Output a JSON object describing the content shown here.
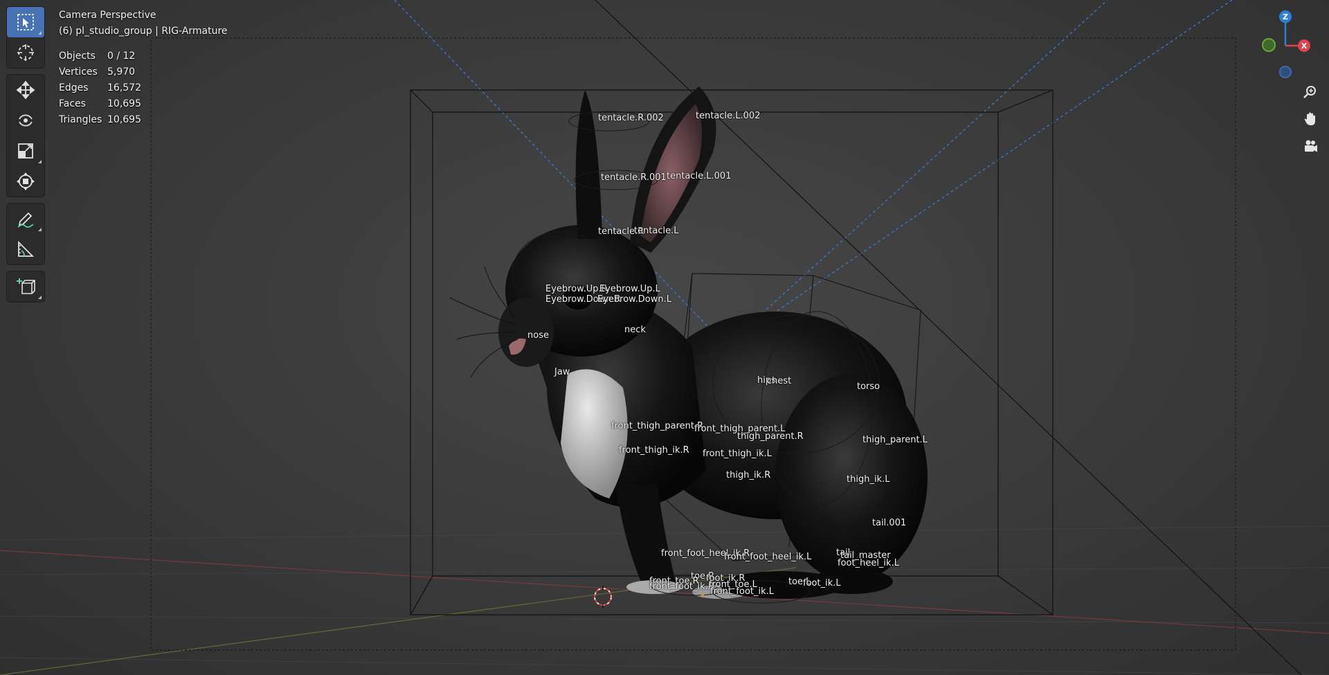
{
  "viewport": {
    "view_name": "Camera Perspective",
    "context": "(6) pl_studio_group | RIG-Armature"
  },
  "stats": [
    {
      "label": "Objects",
      "value": "0 / 12"
    },
    {
      "label": "Vertices",
      "value": "5,970"
    },
    {
      "label": "Edges",
      "value": "16,572"
    },
    {
      "label": "Faces",
      "value": "10,695"
    },
    {
      "label": "Triangles",
      "value": "10,695"
    }
  ],
  "toolbar": {
    "tools": [
      {
        "name": "select-box",
        "icon": "select-box-icon",
        "active": true
      },
      {
        "name": "cursor",
        "icon": "cursor-icon"
      },
      {
        "name": "move",
        "icon": "move-icon"
      },
      {
        "name": "rotate",
        "icon": "rotate-icon"
      },
      {
        "name": "scale",
        "icon": "scale-icon"
      },
      {
        "name": "transform",
        "icon": "transform-icon"
      },
      {
        "name": "annotate",
        "icon": "annotate-icon"
      },
      {
        "name": "measure",
        "icon": "measure-icon"
      },
      {
        "name": "add-cube",
        "icon": "add-cube-icon"
      }
    ]
  },
  "gizmo": {
    "z": "Z",
    "x": "X",
    "z_color": "#2f7fd6",
    "x_color": "#e0414d",
    "y_color": "#6aa63a"
  },
  "bones": {
    "tentacle_R_002": "tentacle.R.002",
    "tentacle_L_002": "tentacle.L.002",
    "tentacle_R_001": "tentacle.R.001",
    "tentacle_L_001": "tentacle.L.001",
    "tentacle_R": "tentacle.R",
    "tentacle_L": "tentacle.L",
    "eyebrow_up_R": "Eyebrow.Up.R",
    "eyebrow_up_L": "Eyebrow.Up.L",
    "eyebrow_down_R": "Eyebrow.Down.R",
    "eyebrow_down_L": "Eyebrow.Down.L",
    "nose": "nose",
    "neck": "neck",
    "jaw": "Jaw",
    "hips": "hips",
    "chest": "chest",
    "torso": "torso",
    "front_thigh_parent_R": "front_thigh_parent.R",
    "front_thigh_parent_L": "front_thigh_parent.L",
    "thigh_parent_R": "thigh_parent.R",
    "thigh_parent_L": "thigh_parent.L",
    "front_thigh_ik_R": "front_thigh_ik.R",
    "front_thigh_ik_L": "front_thigh_ik.L",
    "thigh_ik_R": "thigh_ik.R",
    "thigh_ik_L": "thigh_ik.L",
    "tail_001": "tail.001",
    "tail": "tail",
    "tail_master": "tail_master",
    "front_foot_heel_ik_R": "front_foot_heel_ik.R",
    "front_foot_heel_ik_L": "front_foot_heel_ik.L",
    "foot_heel_ik_L": "foot_heel_ik.L",
    "toe_R": "toe.R",
    "foot_ik_R": "foot_ik.R",
    "front_toe_R": "front_toe.R",
    "front_foot_ik_R": "front_foot_ik.R",
    "front_toe_L": "front_toe.L",
    "front_foot_ik_L": "front_foot_ik.L",
    "toe_L": "toe.L",
    "foot_ik_L": "foot_ik.L"
  }
}
